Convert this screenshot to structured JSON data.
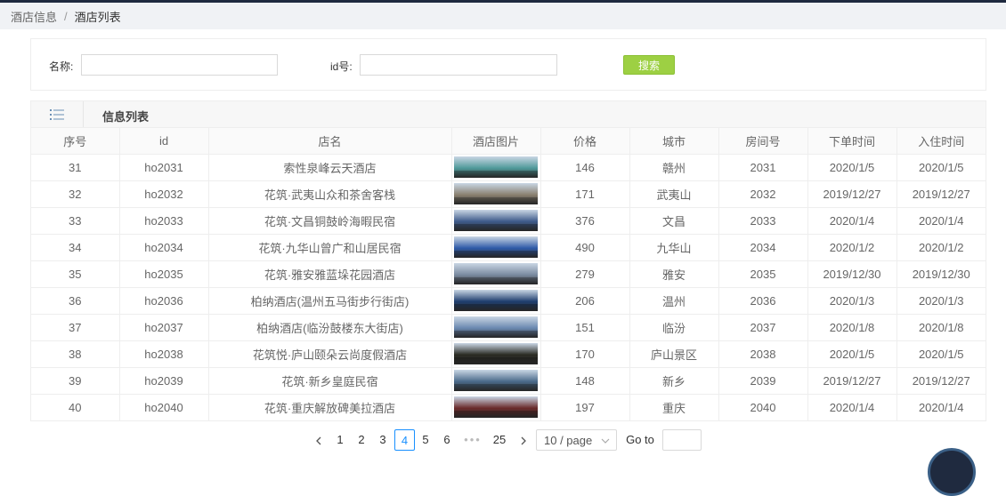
{
  "breadcrumb": {
    "parent": "酒店信息",
    "separator": "/",
    "current": "酒店列表"
  },
  "search": {
    "name_label": "名称:",
    "name_value": "",
    "id_label": "id号:",
    "id_value": "",
    "button_label": "搜索"
  },
  "list": {
    "title": "信息列表",
    "columns": [
      "序号",
      "id",
      "店名",
      "酒店图片",
      "价格",
      "城市",
      "房间号",
      "下单时间",
      "入住时间"
    ],
    "rows": [
      {
        "no": "31",
        "id": "ho2031",
        "name": "索性泉峰云天酒店",
        "img": "hotel-photo",
        "price": "146",
        "city": "赣州",
        "room": "2031",
        "order_time": "2020/1/5",
        "checkin_time": "2020/1/5",
        "tint": "#4f9a9a"
      },
      {
        "no": "32",
        "id": "ho2032",
        "name": "花筑·武夷山众和茶舍客栈",
        "img": "hotel-photo",
        "price": "171",
        "city": "武夷山",
        "room": "2032",
        "order_time": "2019/12/27",
        "checkin_time": "2019/12/27",
        "tint": "#8a8070"
      },
      {
        "no": "33",
        "id": "ho2033",
        "name": "花筑·文昌铜鼓岭海暇民宿",
        "img": "hotel-photo",
        "price": "376",
        "city": "文昌",
        "room": "2033",
        "order_time": "2020/1/4",
        "checkin_time": "2020/1/4",
        "tint": "#3d5a8a"
      },
      {
        "no": "34",
        "id": "ho2034",
        "name": "花筑·九华山曾广和山居民宿",
        "img": "hotel-photo",
        "price": "490",
        "city": "九华山",
        "room": "2034",
        "order_time": "2020/1/2",
        "checkin_time": "2020/1/2",
        "tint": "#2e5aa8"
      },
      {
        "no": "35",
        "id": "ho2035",
        "name": "花筑·雅安雅蓝垛花园酒店",
        "img": "hotel-photo",
        "price": "279",
        "city": "雅安",
        "room": "2035",
        "order_time": "2019/12/30",
        "checkin_time": "2019/12/30",
        "tint": "#7a8aa0"
      },
      {
        "no": "36",
        "id": "ho2036",
        "name": "柏纳酒店(温州五马街步行街店)",
        "img": "hotel-photo",
        "price": "206",
        "city": "温州",
        "room": "2036",
        "order_time": "2020/1/3",
        "checkin_time": "2020/1/3",
        "tint": "#1e3d6e"
      },
      {
        "no": "37",
        "id": "ho2037",
        "name": "柏纳酒店(临汾鼓楼东大街店)",
        "img": "hotel-photo",
        "price": "151",
        "city": "临汾",
        "room": "2037",
        "order_time": "2020/1/8",
        "checkin_time": "2020/1/8",
        "tint": "#6a88b0"
      },
      {
        "no": "38",
        "id": "ho2038",
        "name": "花筑悦·庐山颐朵云尚度假酒店",
        "img": "hotel-photo",
        "price": "170",
        "city": "庐山景区",
        "room": "2038",
        "order_time": "2020/1/5",
        "checkin_time": "2020/1/5",
        "tint": "#2a2a22"
      },
      {
        "no": "39",
        "id": "ho2039",
        "name": "花筑·新乡皇庭民宿",
        "img": "hotel-photo",
        "price": "148",
        "city": "新乡",
        "room": "2039",
        "order_time": "2019/12/27",
        "checkin_time": "2019/12/27",
        "tint": "#4a6a8a"
      },
      {
        "no": "40",
        "id": "ho2040",
        "name": "花筑·重庆解放碑美拉酒店",
        "img": "hotel-photo",
        "price": "197",
        "city": "重庆",
        "room": "2040",
        "order_time": "2020/1/4",
        "checkin_time": "2020/1/4",
        "tint": "#6a2a2a"
      }
    ]
  },
  "pagination": {
    "prev_icon": "chevron-left-icon",
    "pages": [
      "1",
      "2",
      "3",
      "4",
      "5",
      "6"
    ],
    "current": "4",
    "ellipsis": "•••",
    "last": "25",
    "next_icon": "chevron-right-icon",
    "page_size": "10 / page",
    "goto_label": "Go to",
    "goto_value": ""
  }
}
